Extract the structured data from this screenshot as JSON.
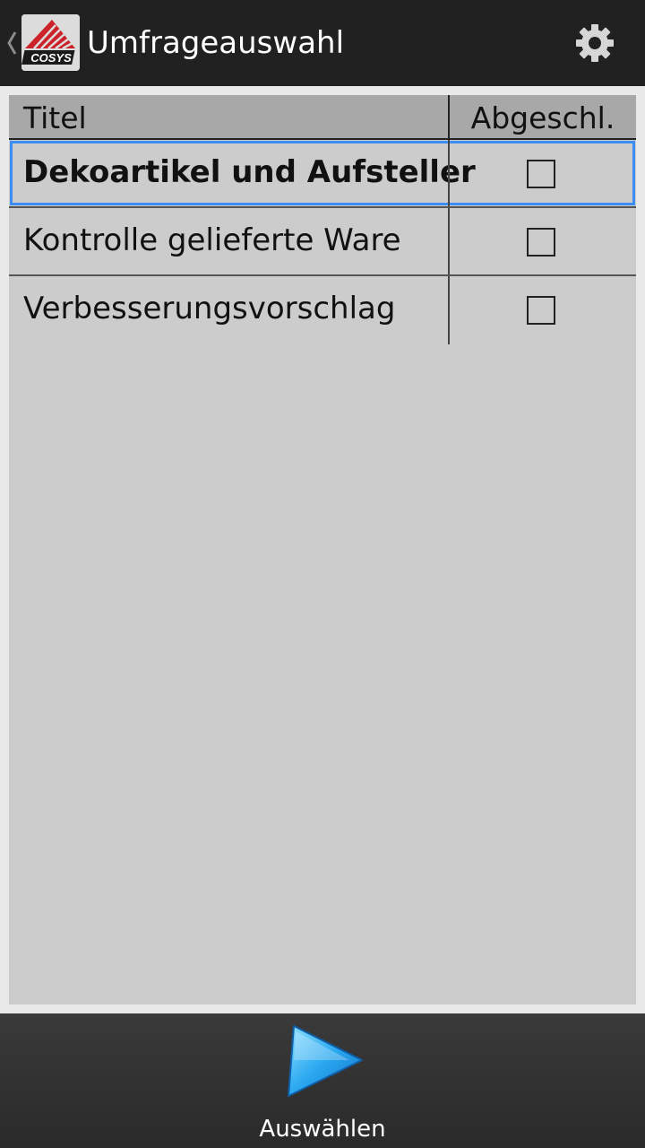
{
  "header": {
    "title": "Umfrageauswahl",
    "logo_text": "COSYS",
    "up_icon": "chevron-left-icon",
    "settings_icon": "gear-icon"
  },
  "table": {
    "columns": [
      "Titel",
      "Abgeschl."
    ],
    "rows": [
      {
        "title": "Dekoartikel und Aufsteller",
        "completed": false,
        "selected": true
      },
      {
        "title": "Kontrolle gelieferte Ware",
        "completed": false,
        "selected": false
      },
      {
        "title": "Verbesserungsvorschlag",
        "completed": false,
        "selected": false
      }
    ]
  },
  "footer": {
    "select_label": "Auswählen",
    "select_icon": "play-icon"
  },
  "colors": {
    "action_bar": "#212121",
    "table_bg": "#cccccc",
    "header_bg": "#a8a8a8",
    "selection": "#3d8ef0",
    "accent_blue": "#2aa8f0"
  }
}
